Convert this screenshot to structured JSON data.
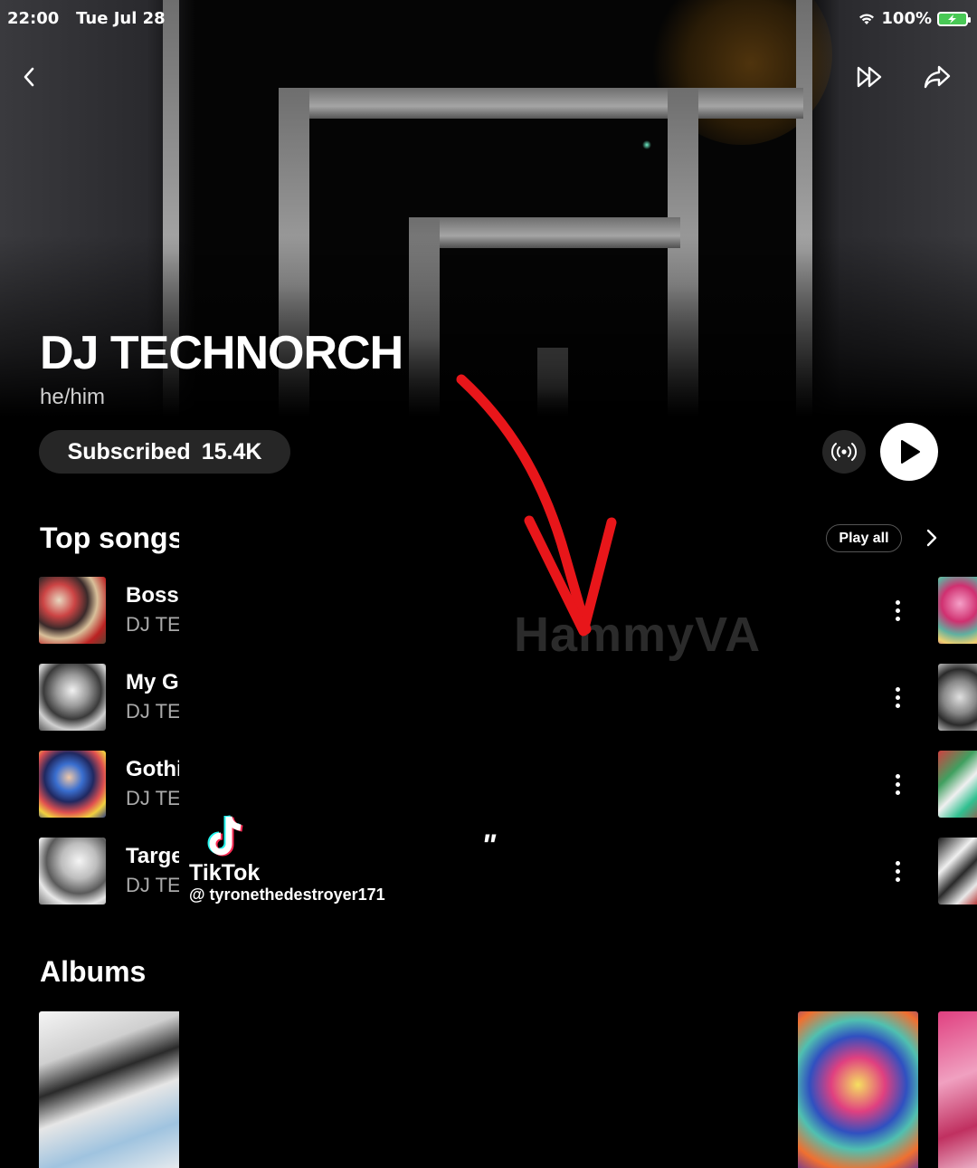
{
  "status_bar": {
    "time": "22:00",
    "date": "Tue Jul 28",
    "battery": "100%"
  },
  "artist": {
    "name": "DJ TECHNORCH",
    "pronouns": "he/him"
  },
  "subscribe": {
    "label": "Subscribed",
    "count": "15.4K"
  },
  "top_songs": {
    "title": "Top songs",
    "play_all_label": "Play all",
    "items": [
      {
        "title": "Boss",
        "artist": "DJ TE"
      },
      {
        "title": "My G",
        "artist": "DJ TE"
      },
      {
        "title": "Gothi",
        "artist": "DJ TE"
      },
      {
        "title": "Targe",
        "artist": "DJ TE"
      }
    ]
  },
  "albums": {
    "title": "Albums"
  },
  "overlay": {
    "watermark": "HammyVA",
    "quote": "\"",
    "tiktok_name": "TikTok",
    "tiktok_handle": "@ tyronethedestroyer171"
  },
  "colors": {
    "arrow": "#e8161a",
    "play_button": "#ffffff",
    "battery": "#48c955"
  },
  "icons": [
    "back-icon",
    "skip-forward-icon",
    "share-icon",
    "wifi-icon",
    "radio-icon",
    "play-icon",
    "chevron-right-icon",
    "more-vert-icon",
    "tiktok-logo-icon"
  ]
}
